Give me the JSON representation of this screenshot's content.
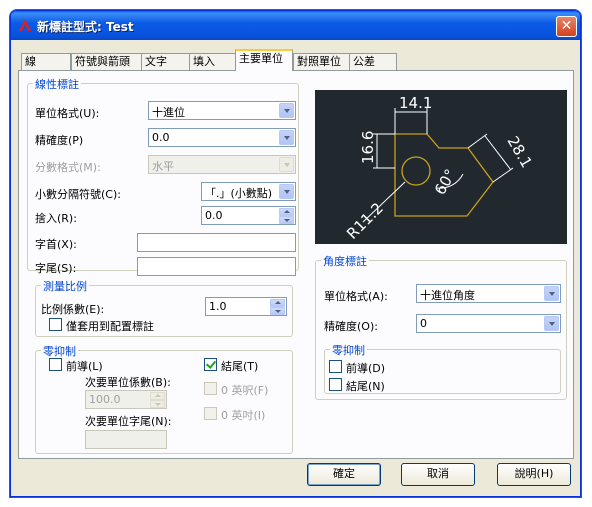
{
  "window": {
    "title": "新標註型式: Test",
    "close_glyph": "✕"
  },
  "tabs": [
    "線",
    "符號與箭頭",
    "文字",
    "填入",
    "主要單位",
    "對照單位",
    "公差"
  ],
  "linear": {
    "group_title": "線性標註",
    "unit_format_label": "單位格式(U):",
    "unit_format_value": "十進位",
    "precision_label": "精確度(P)",
    "precision_value": "0.0",
    "fraction_format_label": "分數格式(M):",
    "fraction_format_value": "水平",
    "decimal_separator_label": "小數分隔符號(C):",
    "decimal_separator_value": "「.」(小數點)",
    "round_off_label": "捨入(R):",
    "round_off_value": "0.0",
    "prefix_label": "字首(X):",
    "prefix_value": "",
    "suffix_label": "字尾(S):",
    "suffix_value": ""
  },
  "measurement_scale": {
    "group_title": "測量比例",
    "scale_factor_label": "比例係數(E):",
    "scale_factor_value": "1.0",
    "layout_only_label": "僅套用到配置標註"
  },
  "zero_suppression": {
    "group_title": "零抑制",
    "leading_label": "前導(L)",
    "sub_units_factor_label": "次要單位係數(B):",
    "sub_units_factor_value": "100.0",
    "sub_unit_suffix_label": "次要單位字尾(N):",
    "sub_unit_suffix_value": "",
    "trailing_label": "結尾(T)",
    "zero_feet_label": "0 英呎(F)",
    "zero_inches_label": "0 英吋(I)"
  },
  "angular": {
    "group_title": "角度標註",
    "unit_format_label": "單位格式(A):",
    "unit_format_value": "十進位角度",
    "precision_label": "精確度(O):",
    "precision_value": "0",
    "zero_group_title": "零抑制",
    "leading_label": "前導(D)",
    "trailing_label": "結尾(N)"
  },
  "preview": {
    "dim_top": "14.1",
    "dim_left": "16.6",
    "dim_right": "28.1",
    "dim_angle": "60°",
    "dim_radius": "R11.2",
    "colors": {
      "background": "#22292e",
      "geometry": "#c8a020",
      "dimension": "#ffffff"
    }
  },
  "footer": {
    "ok_label": "確定",
    "cancel_label": "取消",
    "help_label": "說明(H)"
  }
}
